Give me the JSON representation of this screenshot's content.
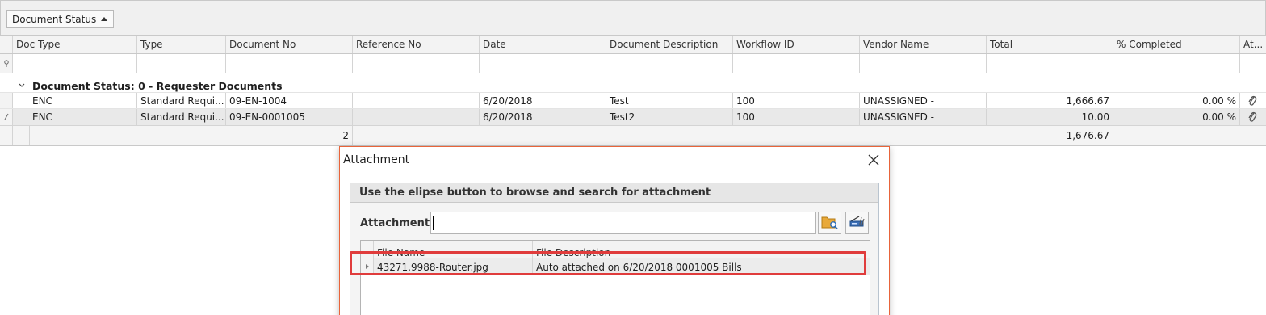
{
  "group_panel": {
    "button_label": "Document Status"
  },
  "grid": {
    "columns": [
      "Doc Type",
      "Type",
      "Document No",
      "Reference No",
      "Date",
      "Document Description",
      "Workflow ID",
      "Vendor Name",
      "Total",
      "% Completed",
      "At..."
    ],
    "group_title": "Document Status: 0 - Requester Documents",
    "rows": [
      {
        "doc_type": "ENC",
        "type": "Standard Requi...",
        "document_no": "09-EN-1004",
        "reference_no": "",
        "date": "6/20/2018",
        "description": "Test",
        "workflow_id": "100",
        "vendor": "UNASSIGNED -",
        "total": "1,666.67",
        "completed": "0.00 %"
      },
      {
        "doc_type": "ENC",
        "type": "Standard Requi...",
        "document_no": "09-EN-0001005",
        "reference_no": "",
        "date": "6/20/2018",
        "description": "Test2",
        "workflow_id": "100",
        "vendor": "UNASSIGNED -",
        "total": "10.00",
        "completed": "0.00 %"
      }
    ],
    "footer": {
      "count": "2",
      "total": "1,676.67"
    }
  },
  "dialog": {
    "title": "Attachment",
    "group_header": "Use the elipse button to browse and  search for attachment",
    "attachment_label": "Attachment",
    "attachment_value": "",
    "inner_grid": {
      "columns": [
        "File Name",
        "File Description"
      ],
      "rows": [
        {
          "file_name": "43271.9988-Router.jpg",
          "file_description": "Auto attached on 6/20/2018 0001005 Bills"
        }
      ]
    }
  }
}
